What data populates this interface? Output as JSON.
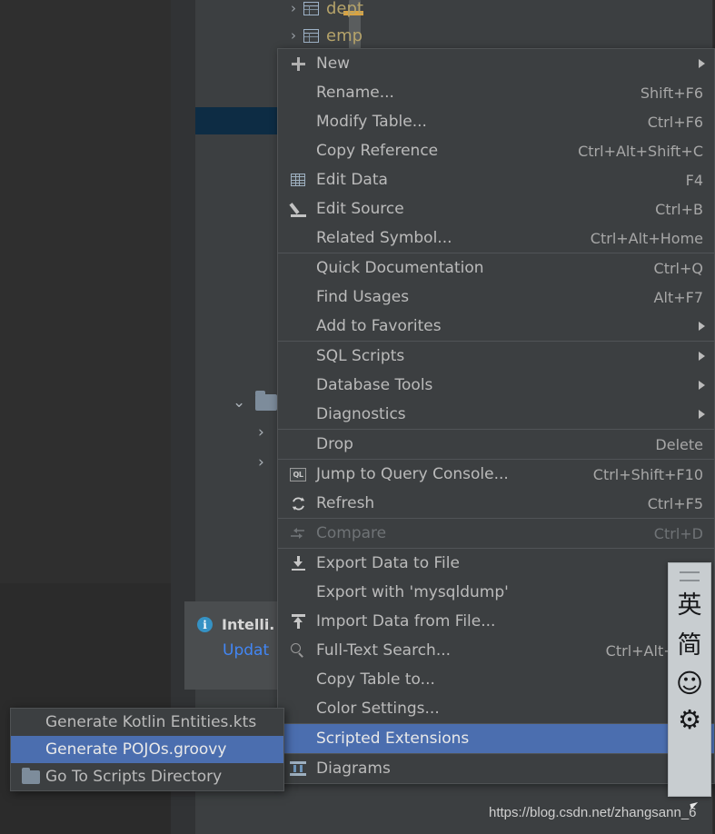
{
  "tree": {
    "items": [
      {
        "label": "dept",
        "icon": "table-icon",
        "chevron": "›"
      },
      {
        "label": "emp",
        "icon": "table-icon",
        "chevron": "›"
      }
    ],
    "folder_chevron": "⌄",
    "child_chevron_1": "›",
    "child_chevron_2": "›"
  },
  "notification": {
    "icon": "info-icon",
    "icon_glyph": "i",
    "title": "Intelli.",
    "link": "Updat"
  },
  "context_menu": {
    "groups": [
      {
        "items": [
          {
            "label": "New",
            "icon": "plus-icon",
            "shortcut": "",
            "submenu": true,
            "name": "menu-item-new"
          },
          {
            "label": "Rename...",
            "underline": "R",
            "icon": "",
            "shortcut": "Shift+F6",
            "submenu": false,
            "name": "menu-item-rename"
          },
          {
            "label": "Modify Table...",
            "icon": "",
            "shortcut": "Ctrl+F6",
            "submenu": false,
            "name": "menu-item-modify-table"
          },
          {
            "label": "Copy Reference",
            "underline": "y",
            "icon": "",
            "shortcut": "Ctrl+Alt+Shift+C",
            "submenu": false,
            "name": "menu-item-copy-reference"
          },
          {
            "label": "Edit Data",
            "icon": "grid-icon",
            "shortcut": "F4",
            "submenu": false,
            "name": "menu-item-edit-data"
          },
          {
            "label": "Edit Source",
            "icon": "pencil-icon",
            "shortcut": "Ctrl+B",
            "submenu": false,
            "name": "menu-item-edit-source"
          },
          {
            "label": "Related Symbol...",
            "underline": "R",
            "icon": "",
            "shortcut": "Ctrl+Alt+Home",
            "submenu": false,
            "name": "menu-item-related-symbol"
          }
        ]
      },
      {
        "items": [
          {
            "label": "Quick Documentation",
            "underline": "D",
            "icon": "",
            "shortcut": "Ctrl+Q",
            "submenu": false,
            "name": "menu-item-quick-documentation"
          },
          {
            "label": "Find Usages",
            "underline": "U",
            "icon": "",
            "shortcut": "Alt+F7",
            "submenu": false,
            "name": "menu-item-find-usages"
          },
          {
            "label": "Add to Favorites",
            "underline": "a",
            "icon": "",
            "shortcut": "",
            "submenu": true,
            "name": "menu-item-add-to-favorites"
          }
        ]
      },
      {
        "items": [
          {
            "label": "SQL Scripts",
            "icon": "",
            "shortcut": "",
            "submenu": true,
            "name": "menu-item-sql-scripts"
          },
          {
            "label": "Database Tools",
            "icon": "",
            "shortcut": "",
            "submenu": true,
            "name": "menu-item-database-tools"
          },
          {
            "label": "Diagnostics",
            "icon": "",
            "shortcut": "",
            "submenu": true,
            "name": "menu-item-diagnostics"
          }
        ]
      },
      {
        "items": [
          {
            "label": "Drop",
            "icon": "",
            "shortcut": "Delete",
            "submenu": false,
            "name": "menu-item-drop"
          }
        ]
      },
      {
        "items": [
          {
            "label": "Jump to Query Console...",
            "icon": "query-console-icon",
            "shortcut": "Ctrl+Shift+F10",
            "submenu": false,
            "name": "menu-item-jump-to-query-console"
          },
          {
            "label": "Refresh",
            "icon": "refresh-icon",
            "shortcut": "Ctrl+F5",
            "submenu": false,
            "name": "menu-item-refresh"
          }
        ]
      },
      {
        "items": [
          {
            "label": "Compare",
            "icon": "compare-icon",
            "shortcut": "Ctrl+D",
            "submenu": false,
            "disabled": true,
            "name": "menu-item-compare"
          }
        ]
      },
      {
        "items": [
          {
            "label": "Export Data to File",
            "underline": "F",
            "icon": "export-icon",
            "shortcut": "",
            "submenu": false,
            "name": "menu-item-export-data-to-file"
          },
          {
            "label": "Export with 'mysqldump'",
            "icon": "",
            "shortcut": "",
            "submenu": false,
            "name": "menu-item-export-with-mysqldump"
          },
          {
            "label": "Import Data from File...",
            "underline": "F",
            "icon": "import-icon",
            "shortcut": "",
            "submenu": false,
            "name": "menu-item-import-data-from-file"
          },
          {
            "label": "Full-Text Search...",
            "icon": "search-icon",
            "shortcut": "Ctrl+Alt+Shif",
            "submenu": false,
            "name": "menu-item-full-text-search"
          },
          {
            "label": "Copy Table to...",
            "icon": "",
            "shortcut": "",
            "submenu": false,
            "name": "menu-item-copy-table-to"
          },
          {
            "label": "Color Settings...",
            "icon": "",
            "shortcut": "",
            "submenu": false,
            "name": "menu-item-color-settings"
          }
        ]
      },
      {
        "items": [
          {
            "label": "Scripted Extensions",
            "icon": "",
            "shortcut": "",
            "submenu": true,
            "selected": true,
            "name": "menu-item-scripted-extensions"
          }
        ]
      },
      {
        "items": [
          {
            "label": "Diagrams",
            "icon": "diagrams-icon",
            "shortcut": "",
            "submenu": false,
            "name": "menu-item-diagrams"
          }
        ]
      }
    ]
  },
  "submenu": {
    "items": [
      {
        "label": "Generate Kotlin Entities.kts",
        "icon": "",
        "selected": false,
        "name": "submenu-item-generate-kotlin-entities"
      },
      {
        "label": "Generate POJOs.groovy",
        "icon": "",
        "selected": true,
        "name": "submenu-item-generate-pojos-groovy"
      },
      {
        "label": "Go To Scripts Directory",
        "icon": "folder-icon",
        "selected": false,
        "name": "submenu-item-go-to-scripts-directory"
      }
    ]
  },
  "ime_bar": {
    "handle": "drag-handle-icon",
    "mode_language": "英",
    "mode_shape": "简",
    "emoji": "☺",
    "settings": "⚙"
  },
  "watermark": {
    "url": "https://blog.csdn.net/zhangsann_6"
  },
  "colors": {
    "menu_bg": "#3c3f41",
    "menu_border": "#4f5254",
    "selection": "#4b6eaf",
    "text": "#bbbbbb",
    "disabled_text": "#6f7376",
    "tree_text": "#b5a36a",
    "marker_yellow": "#d9a343",
    "link_blue": "#4286f4",
    "info_blue": "#3592c4",
    "editor_bg": "#2f2f2f",
    "select_block": "#0d2c44"
  },
  "markers": {
    "positions": [
      12,
      70,
      110,
      168,
      207,
      265,
      305,
      363,
      402
    ]
  }
}
